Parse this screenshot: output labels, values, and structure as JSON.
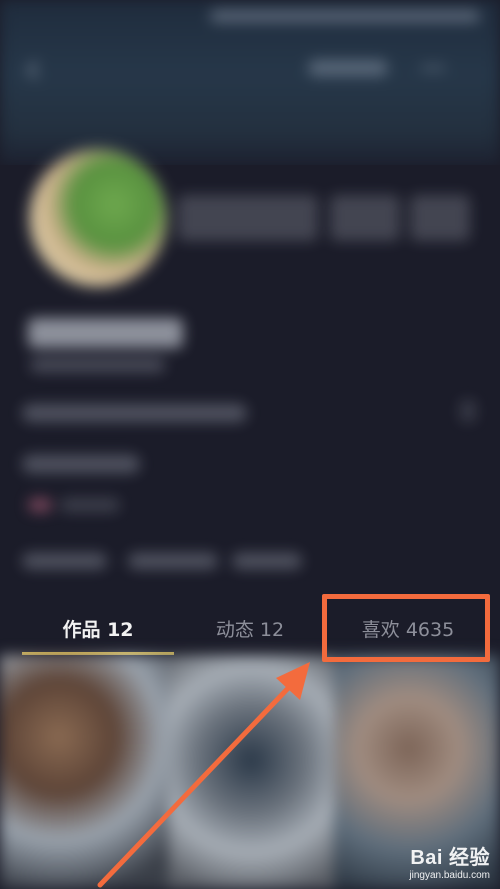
{
  "tabs": [
    {
      "label": "作品 12",
      "active": true
    },
    {
      "label": "动态 12",
      "active": false
    },
    {
      "label": "喜欢 4635",
      "active": false
    }
  ],
  "colors": {
    "active_tab": "#f2f2f2",
    "inactive_tab": "#8d8f9a",
    "tab_underline": "#e6c34c",
    "highlight": "#f36b3d",
    "background": "#1b1c29"
  },
  "icons": [
    "back-arrow-icon",
    "more-icon"
  ],
  "watermark": {
    "brand": "Bai 经验",
    "url": "jingyan.baidu.com"
  }
}
